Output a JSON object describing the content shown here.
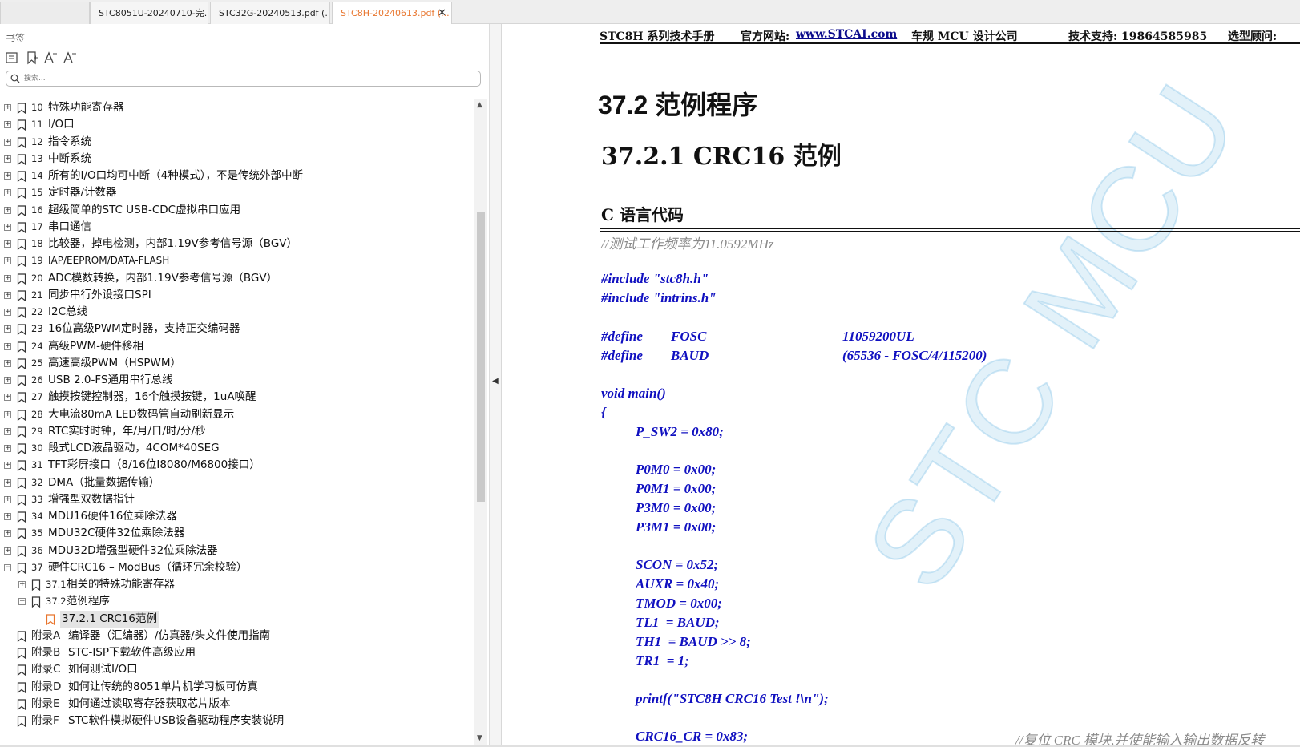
{
  "tabs": [
    {
      "label": "STC8051U-20240710-完...",
      "active": false
    },
    {
      "label": "STC32G-20240513.pdf (...",
      "active": false
    },
    {
      "label": "STC8H-20240613.pdf (...",
      "active": true
    }
  ],
  "tab_close": "✕",
  "sidebar": {
    "header": "书签",
    "tool_icons": [
      "expand-all-icon",
      "add-bookmark-icon",
      "increase-font-icon",
      "decrease-font-icon"
    ],
    "search_placeholder": "搜索..."
  },
  "bookmarks": [
    {
      "num": "10",
      "title": "特殊功能寄存器",
      "level": 0,
      "expand": "+"
    },
    {
      "num": "11",
      "title": "I/O口",
      "level": 0,
      "expand": "+"
    },
    {
      "num": "12",
      "title": "指令系统",
      "level": 0,
      "expand": "+"
    },
    {
      "num": "13",
      "title": "中断系统",
      "level": 0,
      "expand": "+"
    },
    {
      "num": "14",
      "title": "所有的I/O口均可中断（4种模式），不是传统外部中断",
      "level": 0,
      "expand": "+"
    },
    {
      "num": "15",
      "title": "定时器/计数器",
      "level": 0,
      "expand": "+"
    },
    {
      "num": "16",
      "title": "超级简单的STC USB-CDC虚拟串口应用",
      "level": 0,
      "expand": "+"
    },
    {
      "num": "17",
      "title": "串口通信",
      "level": 0,
      "expand": "+"
    },
    {
      "num": "18",
      "title": "比较器，掉电检测，内部1.19V参考信号源（BGV）",
      "level": 0,
      "expand": "+"
    },
    {
      "num": "19",
      "title": "IAP/EEPROM/DATA-FLASH",
      "level": 0,
      "expand": "+",
      "small": true
    },
    {
      "num": "20",
      "title": "ADC模数转换，内部1.19V参考信号源（BGV）",
      "level": 0,
      "expand": "+"
    },
    {
      "num": "21",
      "title": "同步串行外设接口SPI",
      "level": 0,
      "expand": "+"
    },
    {
      "num": "22",
      "title": "I2C总线",
      "level": 0,
      "expand": "+"
    },
    {
      "num": "23",
      "title": "16位高级PWM定时器，支持正交编码器",
      "level": 0,
      "expand": "+"
    },
    {
      "num": "24",
      "title": "高级PWM-硬件移相",
      "level": 0,
      "expand": "+"
    },
    {
      "num": "25",
      "title": "高速高级PWM（HSPWM）",
      "level": 0,
      "expand": "+"
    },
    {
      "num": "26",
      "title": "USB 2.0-FS通用串行总线",
      "level": 0,
      "expand": "+"
    },
    {
      "num": "27",
      "title": "触摸按键控制器，16个触摸按键，1uA唤醒",
      "level": 0,
      "expand": "+"
    },
    {
      "num": "28",
      "title": "大电流80mA LED数码管自动刷新显示",
      "level": 0,
      "expand": "+"
    },
    {
      "num": "29",
      "title": "RTC实时时钟，年/月/日/时/分/秒",
      "level": 0,
      "expand": "+"
    },
    {
      "num": "30",
      "title": "段式LCD液晶驱动，4COM*40SEG",
      "level": 0,
      "expand": "+"
    },
    {
      "num": "31",
      "title": "TFT彩屏接口（8/16位I8080/M6800接口）",
      "level": 0,
      "expand": "+"
    },
    {
      "num": "32",
      "title": "DMA（批量数据传输）",
      "level": 0,
      "expand": "+"
    },
    {
      "num": "33",
      "title": "增强型双数据指针",
      "level": 0,
      "expand": "+"
    },
    {
      "num": "34",
      "title": "MDU16硬件16位乘除法器",
      "level": 0,
      "expand": "+"
    },
    {
      "num": "35",
      "title": "MDU32C硬件32位乘除法器",
      "level": 0,
      "expand": "+"
    },
    {
      "num": "36",
      "title": "MDU32D增强型硬件32位乘除法器",
      "level": 0,
      "expand": "+"
    },
    {
      "num": "37",
      "title": "硬件CRC16 – ModBus（循环冗余校验）",
      "level": 0,
      "expand": "−"
    },
    {
      "num": "37.1",
      "title": "相关的特殊功能寄存器",
      "level": 1,
      "expand": "+"
    },
    {
      "num": "37.2",
      "title": "范例程序",
      "level": 1,
      "expand": "−"
    },
    {
      "num": "",
      "title": "37.2.1 CRC16范例",
      "level": 2,
      "expand": "",
      "selected": true
    },
    {
      "num": "附录A",
      "title": "编译器（汇编器）/仿真器/头文件使用指南",
      "level": 0,
      "expand": ""
    },
    {
      "num": "附录B",
      "title": "STC-ISP下载软件高级应用",
      "level": 0,
      "expand": ""
    },
    {
      "num": "附录C",
      "title": "如何测试I/O口",
      "level": 0,
      "expand": ""
    },
    {
      "num": "附录D",
      "title": "如何让传统的8051单片机学习板可仿真",
      "level": 0,
      "expand": ""
    },
    {
      "num": "附录E",
      "title": "如何通过读取寄存器获取芯片版本",
      "level": 0,
      "expand": ""
    },
    {
      "num": "附录F",
      "title": "STC软件模拟硬件USB设备驱动程序安装说明",
      "level": 0,
      "expand": ""
    }
  ],
  "scroll_up": "▲",
  "scroll_down": "▼",
  "collapse_glyph": "◀",
  "document": {
    "header": {
      "title": "STC8H 系列技术手册",
      "site_label": "官方网站:",
      "site_url": "www.STCAI.com",
      "company": "车规 MCU 设计公司",
      "support": "技术支持: 19864585985",
      "select": "选型顾问:"
    },
    "h1": "37.2 范例程序",
    "h2": "37.2.1  CRC16 范例",
    "h3": "C 语言代码",
    "code": [
      {
        "text": "//测试工作频率为11.0592MHz",
        "type": "comment"
      },
      {
        "text": "#include \"stc8h.h\"",
        "type": "code"
      },
      {
        "text": "#include \"intrins.h\"",
        "type": "code"
      },
      {
        "text": "#define",
        "type": "code"
      },
      {
        "text": "FOSC",
        "type": "code"
      },
      {
        "text": "11059200UL",
        "type": "code"
      },
      {
        "text": "#define",
        "type": "code"
      },
      {
        "text": "BAUD",
        "type": "code"
      },
      {
        "text": "(65536 - FOSC/4/115200)",
        "type": "code"
      },
      {
        "text": "void main()",
        "type": "code"
      },
      {
        "text": "{",
        "type": "code"
      },
      {
        "text": "P_SW2 = 0x80;",
        "type": "code"
      },
      {
        "text": "P0M0 = 0x00;",
        "type": "code"
      },
      {
        "text": "P0M1 = 0x00;",
        "type": "code"
      },
      {
        "text": "P3M0 = 0x00;",
        "type": "code"
      },
      {
        "text": "P3M1 = 0x00;",
        "type": "code"
      },
      {
        "text": "SCON = 0x52;",
        "type": "code"
      },
      {
        "text": "AUXR = 0x40;",
        "type": "code"
      },
      {
        "text": "TMOD = 0x00;",
        "type": "code"
      },
      {
        "text": "TL1  = BAUD;",
        "type": "code"
      },
      {
        "text": "TH1  = BAUD >> 8;",
        "type": "code"
      },
      {
        "text": "TR1  = 1;",
        "type": "code"
      },
      {
        "text": "printf(\"STC8H CRC16 Test !\\n\");",
        "type": "code"
      },
      {
        "text": "CRC16_CR = 0x83;",
        "type": "code"
      },
      {
        "text": "//复位 CRC 模块,并使能输入输出数据反转",
        "type": "comment"
      }
    ],
    "watermark": "STC MCU"
  }
}
